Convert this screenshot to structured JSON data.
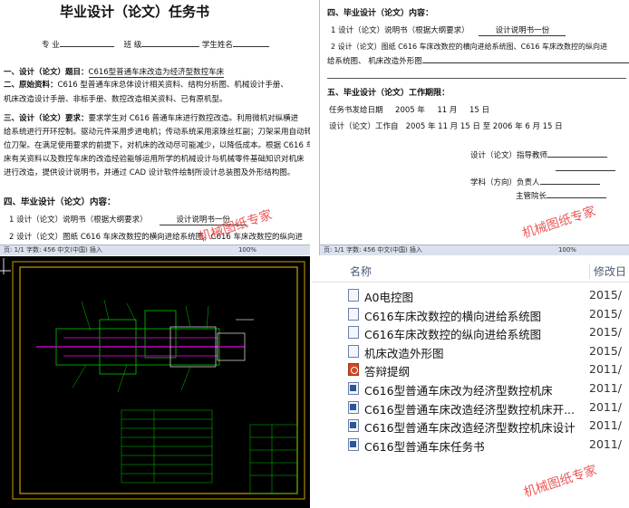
{
  "doc_left": {
    "title": "毕业设计（论文）任务书",
    "row_major": "专  业",
    "row_class": "班  级",
    "row_student": "学生姓名",
    "s1_label": "一、设计（论文）题目：",
    "s1_text": "C616型普通车床改造为经济型数控车床",
    "s2_label": "二、原始资料：",
    "s2_text": "C616 型普通车床总体设计相关资料、结构分析图、机械设计手册、",
    "s2_text2": "机床改造设计手册、非标手册、数控改造相关资料、已有原机型。",
    "s3_label": "三、设计（论文）要求：",
    "s3_l1": "要求学生对 C616 普通车床进行数控改造。利用微机对纵横进",
    "s3_l2": "给系统进行开环控制。驱动元件采用步进电机；传动系统采用滚珠丝杠副；刀架采用自动转",
    "s3_l3": "位刀架。在满足使用要求的前提下，对机床的改动尽可能减少，以降低成本。根据 C616 车",
    "s3_l4": "床有关资料以及数控车床的改造经验能够运用所学的机械设计与机械零件基础知识对机床",
    "s3_l5": "进行改造，提供设计说明书，并通过 CAD 设计软件绘制所设计总装图及外形结构图。",
    "s4_label": "四、毕业设计（论文）内容：",
    "s4_l1a": "1 设计（论文）说明书（根据大纲要求）",
    "s4_l1b": "设计说明书一份",
    "s4_l2": "2 设计（论文）图纸    C616 车床改数控的横向进给系统图。C616 车床改数控的纵向进",
    "status": "页: 1/1  字数: 456   中文(中国)  插入",
    "zoom": "100%"
  },
  "doc_right": {
    "s4_label": "四、毕业设计（论文）内容：",
    "l1a": "1 设计（论文）说明书（根据大纲要求）",
    "l1b": "设计说明书一份",
    "l2": "2 设计（论文）图纸    C616 车床改数控的横向进给系统图、C616 车床改数控的纵向进",
    "l3": "给系统图、 机床改造外形图",
    "s5_label": "五、毕业设计（论文）工作期限：",
    "date_label": "任务书发给日期",
    "date_year": "2005 年",
    "date_month": "11 月",
    "date_day": "15 日",
    "work_label": "设计（论文）工作自",
    "work_from": "2005 年    11 月    15 日  至   2006 年    6 月    15 日",
    "sign1": "设计（论文）指导教师",
    "sign2": "学科（方向）负责人",
    "sign3": "主管院长",
    "status": "页: 1/1  字数: 456   中文(中国)  插入",
    "zoom": "100%"
  },
  "files": {
    "col_name": "名称",
    "col_date": "修改日",
    "items": [
      {
        "name": "A0电控图",
        "date": "2015/",
        "icon": "dwg-file-icon"
      },
      {
        "name": "C616车床改数控的横向进给系统图",
        "date": "2015/",
        "icon": "dwg-file-icon"
      },
      {
        "name": "C616车床改数控的纵向进给系统图",
        "date": "2015/",
        "icon": "dwg-file-icon"
      },
      {
        "name": "机床改造外形图",
        "date": "2015/",
        "icon": "dwg-file-icon"
      },
      {
        "name": "答辩提纲",
        "date": "2011/",
        "icon": "ppt-file-icon"
      },
      {
        "name": "C616型普通车床改为经济型数控机床",
        "date": "2011/",
        "icon": "doc-file-icon"
      },
      {
        "name": "C616型普通车床改造经济型数控机床开...",
        "date": "2011/",
        "icon": "doc-file-icon"
      },
      {
        "name": "C616型普通车床改造经济型数控机床设计",
        "date": "2011/",
        "icon": "doc-file-icon"
      },
      {
        "name": "C616型普通车床任务书",
        "date": "2011/",
        "icon": "doc-file-icon"
      }
    ]
  },
  "watermark": "机械图纸专家",
  "colors": {
    "cad_bg": "#000000",
    "cad_frame": "#c8a000",
    "cad_green": "#00c800",
    "cad_magenta": "#c000c0",
    "watermark": "#e83a3a"
  }
}
